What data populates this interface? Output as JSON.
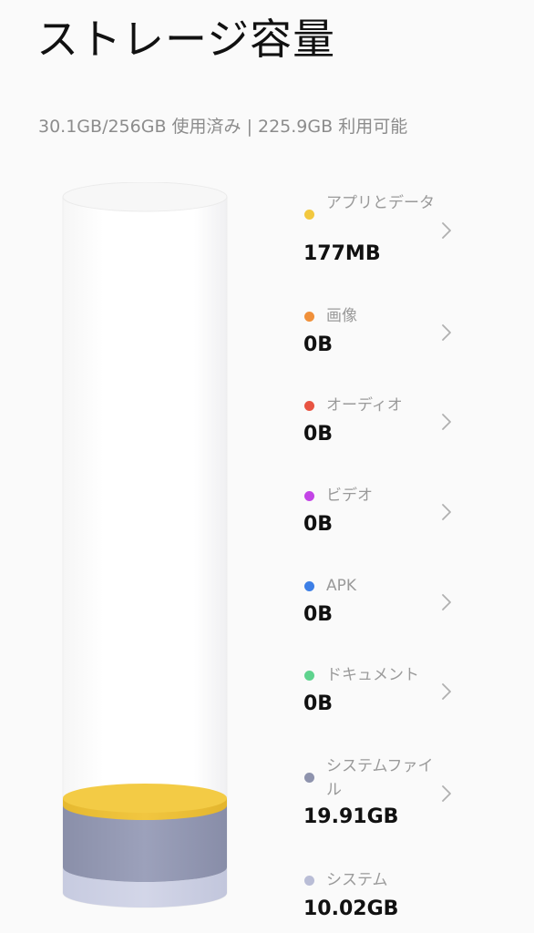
{
  "page": {
    "title": "ストレージ容量",
    "summary": "30.1GB/256GB 使用済み | 225.9GB 利用可能"
  },
  "storage_bar": {
    "total_gb": 256,
    "segments": [
      {
        "name": "システム",
        "color": "#c9cde0"
      },
      {
        "name": "システムファイル",
        "color": "#8e93ad"
      },
      {
        "name": "アプリとデータ",
        "color": "#f2c83f"
      }
    ]
  },
  "categories": [
    {
      "label": "アプリとデータ",
      "size": "177MB",
      "color": "#f2c83f",
      "icon": "chevron-right-icon"
    },
    {
      "label": "画像",
      "size": "0B",
      "color": "#f0903a",
      "icon": "chevron-right-icon"
    },
    {
      "label": "オーディオ",
      "size": "0B",
      "color": "#e85442",
      "icon": "chevron-right-icon"
    },
    {
      "label": "ビデオ",
      "size": "0B",
      "color": "#c344e6",
      "icon": "chevron-right-icon"
    },
    {
      "label": "APK",
      "size": "0B",
      "color": "#3d7fe6",
      "icon": "chevron-right-icon"
    },
    {
      "label": "ドキュメント",
      "size": "0B",
      "color": "#5fd38e",
      "icon": "chevron-right-icon"
    },
    {
      "label": "システムファイル",
      "size": "19.91GB",
      "color": "#8e93ad",
      "icon": "chevron-right-icon"
    },
    {
      "label": "システム",
      "size": "10.02GB",
      "color": "#b9bdd6",
      "icon": "chevron-right-icon"
    }
  ]
}
